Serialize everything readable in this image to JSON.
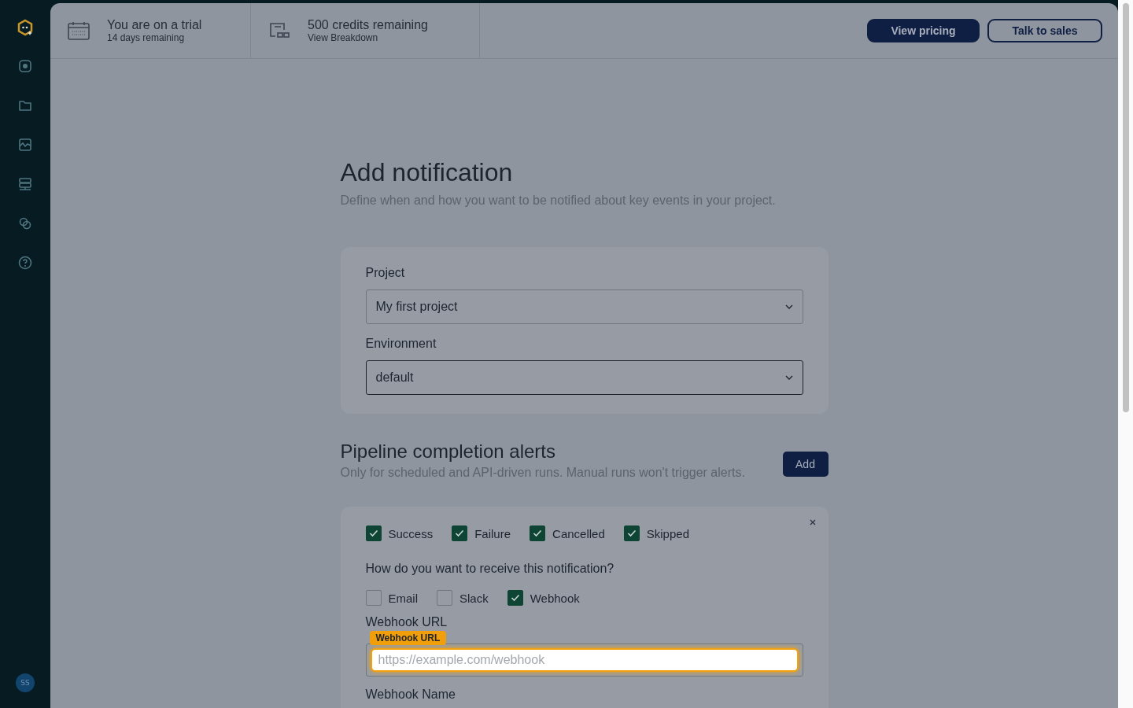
{
  "avatar": "SS",
  "trial": {
    "title": "You are on a trial",
    "subtitle": "14 days remaining"
  },
  "credits": {
    "title": "500 credits remaining",
    "link": "View Breakdown"
  },
  "header_buttons": [
    {
      "label": "View pricing",
      "kind": "primary"
    },
    {
      "label": "Talk to sales",
      "kind": "outline"
    }
  ],
  "page": {
    "title": "Add notification",
    "description": "Define when and how you want to be notified about key events in your project."
  },
  "selects": [
    {
      "label": "Project",
      "value": "My first project",
      "focused": false
    },
    {
      "label": "Environment",
      "value": "default",
      "focused": true
    }
  ],
  "alerts": {
    "title": "Pipeline completion alerts",
    "description": "Only for scheduled and API-driven runs. Manual runs won't trigger alerts.",
    "add_button": "Add"
  },
  "statuses": [
    {
      "label": "Success",
      "checked": true
    },
    {
      "label": "Failure",
      "checked": true
    },
    {
      "label": "Cancelled",
      "checked": true
    },
    {
      "label": "Skipped",
      "checked": true
    }
  ],
  "question": "How do you want to receive this notification?",
  "channels": [
    {
      "label": "Email",
      "checked": false
    },
    {
      "label": "Slack",
      "checked": false
    },
    {
      "label": "Webhook",
      "checked": true
    }
  ],
  "webhook_url": {
    "label": "Webhook URL",
    "tag": "Webhook URL",
    "placeholder": "https://example.com/webhook",
    "highlighted": true
  },
  "webhook_name": {
    "label": "Webhook Name"
  }
}
